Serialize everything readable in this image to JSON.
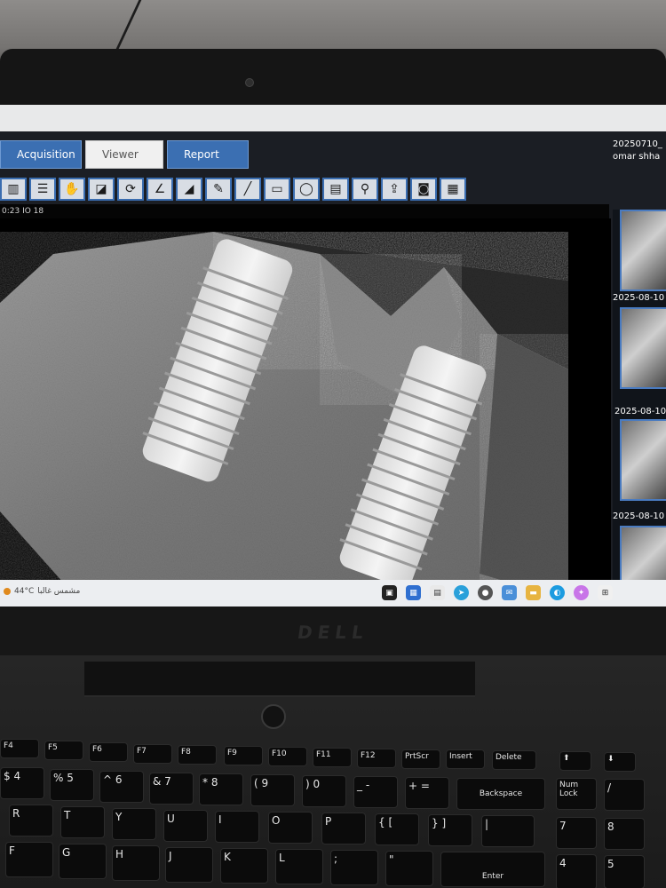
{
  "header": {
    "datetime": "20250710_",
    "user": "omar shha"
  },
  "tabs": [
    {
      "label": "Acquisition",
      "active": false
    },
    {
      "label": "Viewer",
      "active": true
    },
    {
      "label": "Report",
      "active": false
    }
  ],
  "toolbar": {
    "tools": [
      "ruler-icon",
      "layers-icon",
      "hand-icon",
      "contrast-icon",
      "rotate-icon",
      "angle-icon",
      "density-icon",
      "pen-icon",
      "line-icon",
      "rectangle-icon",
      "ellipse-icon",
      "annotation-icon",
      "magnify-icon",
      "export-icon",
      "camera-icon",
      "grid-icon"
    ]
  },
  "viewer": {
    "info": "0:23   IO 18"
  },
  "thumbnails": {
    "dates": [
      "2025-08-10",
      "2025-08-10",
      "2025-08-10 1"
    ]
  },
  "taskbar": {
    "weather_temp": "44°C",
    "weather_desc": "مشمس غالبا"
  },
  "keyboard": {
    "function_keys": [
      "F4",
      "F5",
      "F6",
      "F7",
      "F8",
      "F9",
      "F10",
      "F11",
      "F12",
      "PrtScr",
      "Insert",
      "Delete"
    ],
    "number_row": [
      "$ 4",
      "% 5",
      "^ 6",
      "& 7",
      "* 8",
      "( 9",
      ") 0",
      "_ -",
      "+ ="
    ],
    "letters_row1": [
      "R",
      "T",
      "Y",
      "U",
      "I",
      "O",
      "P",
      "{ [",
      "} ]",
      "|"
    ],
    "letters_row2": [
      "F",
      "G",
      "H",
      "J",
      "K",
      "L",
      ";",
      "\""
    ],
    "special_keys": [
      "Backspace",
      "Num Lock",
      "Enter"
    ],
    "numpad": [
      "/",
      "7",
      "8",
      "4",
      "5"
    ],
    "brand": "DELL"
  },
  "colors": {
    "tab_blue": "#3b6fb2",
    "tab_active": "#f0f0f0",
    "tool_border": "#3a6db0",
    "app_bg": "#1b1e24"
  }
}
